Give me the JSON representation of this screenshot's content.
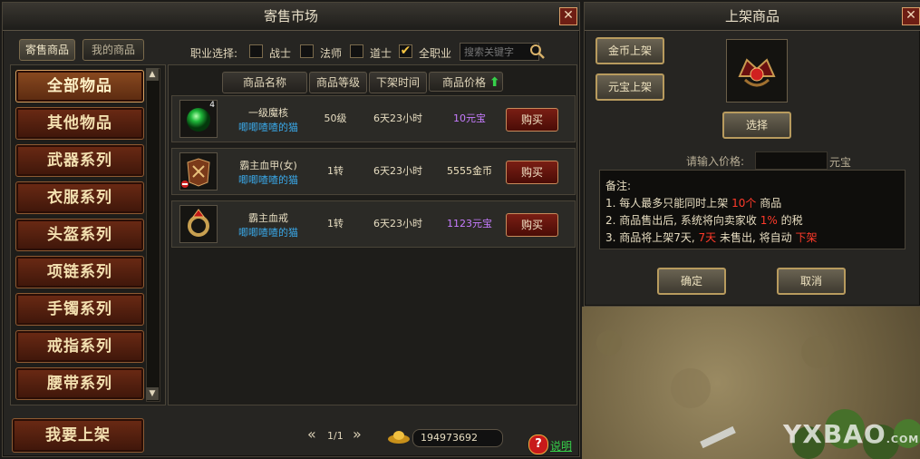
{
  "market": {
    "title": "寄售市场",
    "close": "✕",
    "tabs": [
      "寄售商品",
      "我的商品"
    ],
    "filter": {
      "label": "职业选择:",
      "options": [
        "战士",
        "法师",
        "道士",
        "全职业"
      ],
      "checked": "全职业",
      "search_placeholder": "搜索关键字"
    },
    "categories": [
      "全部物品",
      "其他物品",
      "武器系列",
      "衣服系列",
      "头盔系列",
      "项链系列",
      "手镯系列",
      "戒指系列",
      "腰带系列"
    ],
    "selected_category": "全部物品",
    "sell_button": "我要上架",
    "columns": [
      "商品名称",
      "商品等级",
      "下架时间",
      "商品价格"
    ],
    "rows": [
      {
        "icon": "green-orb-icon",
        "qty": "4",
        "name": "一级魔核",
        "seller": "唧唧喳喳的猫",
        "level": "50级",
        "time": "6天23小时",
        "price": "10元宝",
        "price_color": "#c77cff",
        "buy": "购买"
      },
      {
        "icon": "armor-icon",
        "qty": "",
        "name": "霸主血甲(女)",
        "seller": "唧唧喳喳的猫",
        "level": "1转",
        "time": "6天23小时",
        "price": "5555金币",
        "price_color": "#f0e3c0",
        "buy": "购买"
      },
      {
        "icon": "ring-icon",
        "qty": "",
        "name": "霸主血戒",
        "seller": "唧唧喳喳的猫",
        "level": "1转",
        "time": "6天23小时",
        "price": "1123元宝",
        "price_color": "#c77cff",
        "buy": "购买"
      }
    ],
    "pager": {
      "text": "1/1"
    },
    "balance": "194973692",
    "help": "说明"
  },
  "listing": {
    "title": "上架商品",
    "close": "✕",
    "gold_button": "金币上架",
    "yuanbao_button": "元宝上架",
    "select_button": "选择",
    "price_label": "请输入价格:",
    "price_unit": "元宝",
    "price_value": "",
    "notes_title": "备注:",
    "notes": [
      {
        "pre": "1. 每人最多只能同时上架 ",
        "hl": "10个",
        "post": " 商品"
      },
      {
        "pre": "2. 商品售出后, 系统将向卖家收 ",
        "hl": "1%",
        "post": " 的税"
      },
      {
        "pre": "3. 商品将上架7天, ",
        "hl": "7天",
        "post": " 未售出, 将自动 ",
        "hl2": "下架"
      }
    ],
    "confirm": "确定",
    "cancel": "取消"
  },
  "watermark": {
    "text": "YXBAO",
    "suffix": ".COM"
  },
  "colors": {
    "highlight_red": "#ff3a2a",
    "seller_blue": "#3aa8e8",
    "yuanbao_purple": "#c77cff"
  }
}
